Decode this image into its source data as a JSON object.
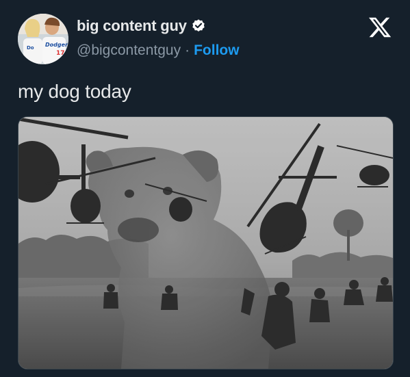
{
  "post": {
    "display_name": "big content guy",
    "handle": "@bigcontentguy",
    "separator": "·",
    "follow_label": "Follow",
    "text": "my dog today",
    "avatar_jersey": "Dodgers",
    "avatar_number": "17"
  },
  "icons": {
    "verified": "verified-badge-icon",
    "logo": "x-logo-icon"
  },
  "colors": {
    "background": "#15202b",
    "accent": "#1d9bf0",
    "secondary_text": "#8b98a5",
    "primary_text": "#e7e9ea"
  }
}
